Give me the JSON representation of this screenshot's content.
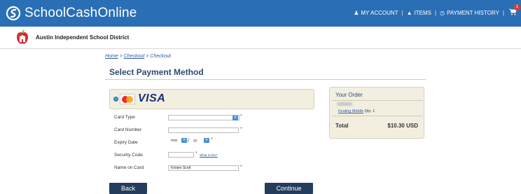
{
  "header": {
    "logo_text": "SchoolCashOnline",
    "nav": {
      "my_account": "MY ACCOUNT",
      "items": "ITEMS",
      "payment_history": "PAYMENT HISTORY",
      "separator": "|",
      "cart_count": "1"
    },
    "icons": [
      "school-cash-logo-icon",
      "user-icon",
      "basket-icon",
      "history-icon",
      "cart-icon"
    ]
  },
  "district": {
    "name": "Austin Independent School District"
  },
  "breadcrumb": {
    "home": "Home",
    "sep": ">",
    "checkout1": "Checkout",
    "checkout2": "Checkout"
  },
  "page_title": "Select Payment Method",
  "payment": {
    "card_brand": "VISA",
    "fields": {
      "card_type": {
        "label": "Card Type",
        "value": ""
      },
      "card_number": {
        "label": "Card Number",
        "value": ""
      },
      "expiry": {
        "label": "Expiry Date",
        "month": "mm",
        "slash": "/",
        "year": "yy"
      },
      "security_code": {
        "label": "Security Code",
        "value": "",
        "help": "What is this?"
      },
      "name_on_card": {
        "label": "Name on Card",
        "value": "Kristen Scott"
      }
    },
    "required_mark": "*"
  },
  "order": {
    "title": "Your Order",
    "item_school": "Kealing Middle",
    "item_qty": "Qty: 1",
    "total_label": "Total",
    "total_value": "$10.30 USD"
  },
  "buttons": {
    "back": "Back",
    "continue": "Continue"
  },
  "colors": {
    "topbar": "#2a6fb5",
    "button": "#253d5c",
    "panel": "#f2efe1",
    "title": "#2b4a6f"
  }
}
